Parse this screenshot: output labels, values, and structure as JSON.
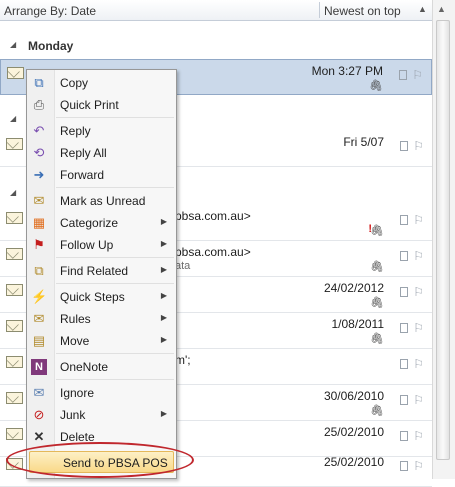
{
  "header": {
    "arrange_label": "Arrange By: Date",
    "sort_label": "Newest on top"
  },
  "groups": [
    {
      "label": "Monday"
    },
    {
      "label": ""
    },
    {
      "label": ""
    }
  ],
  "rows": [
    {
      "from": "",
      "subject": "",
      "date": "Mon 3:27 PM",
      "attachment": true,
      "selected": true
    },
    {
      "from": "",
      "subject": "",
      "date": "Fri 5/07",
      "attachment": false
    },
    {
      "from": "pbsa.com.au>",
      "subject": "",
      "date": "",
      "attachment": true,
      "important": true
    },
    {
      "from": "pbsa.com.au>",
      "subject": "ata",
      "date": "",
      "attachment": true
    },
    {
      "from": "",
      "subject": "",
      "date": "24/02/2012",
      "attachment": true
    },
    {
      "from": "",
      "subject": "",
      "date": "1/08/2011",
      "attachment": true
    },
    {
      "from": "m';",
      "subject": "",
      "date": "",
      "attachment": false
    },
    {
      "from": "",
      "subject": "",
      "date": "30/06/2010",
      "attachment": true
    },
    {
      "from": "",
      "subject": "",
      "date": "25/02/2010",
      "attachment": false
    },
    {
      "from": "",
      "subject": "",
      "date": "25/02/2010",
      "attachment": false
    }
  ],
  "menu": {
    "items": [
      {
        "label": "Copy",
        "icon": "copy-icon",
        "submenu": false
      },
      {
        "label": "Quick Print",
        "icon": "printer-icon",
        "submenu": false
      },
      {
        "label": "Reply",
        "icon": "reply-icon",
        "submenu": false
      },
      {
        "label": "Reply All",
        "icon": "reply-all-icon",
        "submenu": false
      },
      {
        "label": "Forward",
        "icon": "forward-icon",
        "submenu": false
      },
      {
        "label": "Mark as Unread",
        "icon": "envelope-icon",
        "submenu": false
      },
      {
        "label": "Categorize",
        "icon": "categorize-icon",
        "submenu": true
      },
      {
        "label": "Follow Up",
        "icon": "flag-icon",
        "submenu": true
      },
      {
        "label": "Find Related",
        "icon": "find-related-icon",
        "submenu": true
      },
      {
        "label": "Quick Steps",
        "icon": "lightning-icon",
        "submenu": true
      },
      {
        "label": "Rules",
        "icon": "rules-icon",
        "submenu": true
      },
      {
        "label": "Move",
        "icon": "move-icon",
        "submenu": true
      },
      {
        "label": "OneNote",
        "icon": "onenote-icon",
        "submenu": false
      },
      {
        "label": "Ignore",
        "icon": "ignore-icon",
        "submenu": false
      },
      {
        "label": "Junk",
        "icon": "junk-icon",
        "submenu": true
      },
      {
        "label": "Delete",
        "icon": "delete-icon",
        "submenu": false
      },
      {
        "label": "Send to PBSA POS",
        "icon": "",
        "submenu": false
      }
    ]
  },
  "colors": {
    "selection": "#cbd9ea",
    "highlight": "#f9d989",
    "annotation_ellipse": "#c0272d"
  }
}
